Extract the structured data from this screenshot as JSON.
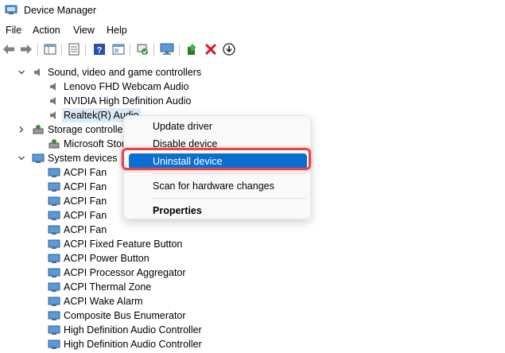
{
  "window": {
    "title": "Device Manager"
  },
  "menu": [
    "File",
    "Action",
    "View",
    "Help"
  ],
  "toolbar": [
    "back-arrow-icon",
    "forward-arrow-icon",
    "properties-icon",
    "list-icon",
    "help-icon",
    "view-icon",
    "scan-icon",
    "monitor-icon",
    "update-driver-icon",
    "uninstall-x-icon",
    "download-icon"
  ],
  "tree": {
    "sound_category": "Sound, video and game controllers",
    "sound_items": [
      "Lenovo FHD Webcam Audio",
      "NVIDIA High Definition Audio",
      "Realtek(R) Audio"
    ],
    "storage_category": "Storage controllers",
    "storage_items": [
      "Microsoft Storage Spaces Controller"
    ],
    "system_category": "System devices",
    "system_items": [
      "ACPI Fan",
      "ACPI Fan",
      "ACPI Fan",
      "ACPI Fan",
      "ACPI Fan",
      "ACPI Fixed Feature Button",
      "ACPI Power Button",
      "ACPI Processor Aggregator",
      "ACPI Thermal Zone",
      "ACPI Wake Alarm",
      "Composite Bus Enumerator",
      "High Definition Audio Controller",
      "High Definition Audio Controller"
    ]
  },
  "context_menu": {
    "update_driver": "Update driver",
    "disable_device": "Disable device",
    "uninstall_device": "Uninstall device",
    "scan_hardware": "Scan for hardware changes",
    "properties": "Properties"
  },
  "colors": {
    "highlight": "#0a6fd0",
    "callout": "#e0474c",
    "selection": "#d9ebf9"
  }
}
